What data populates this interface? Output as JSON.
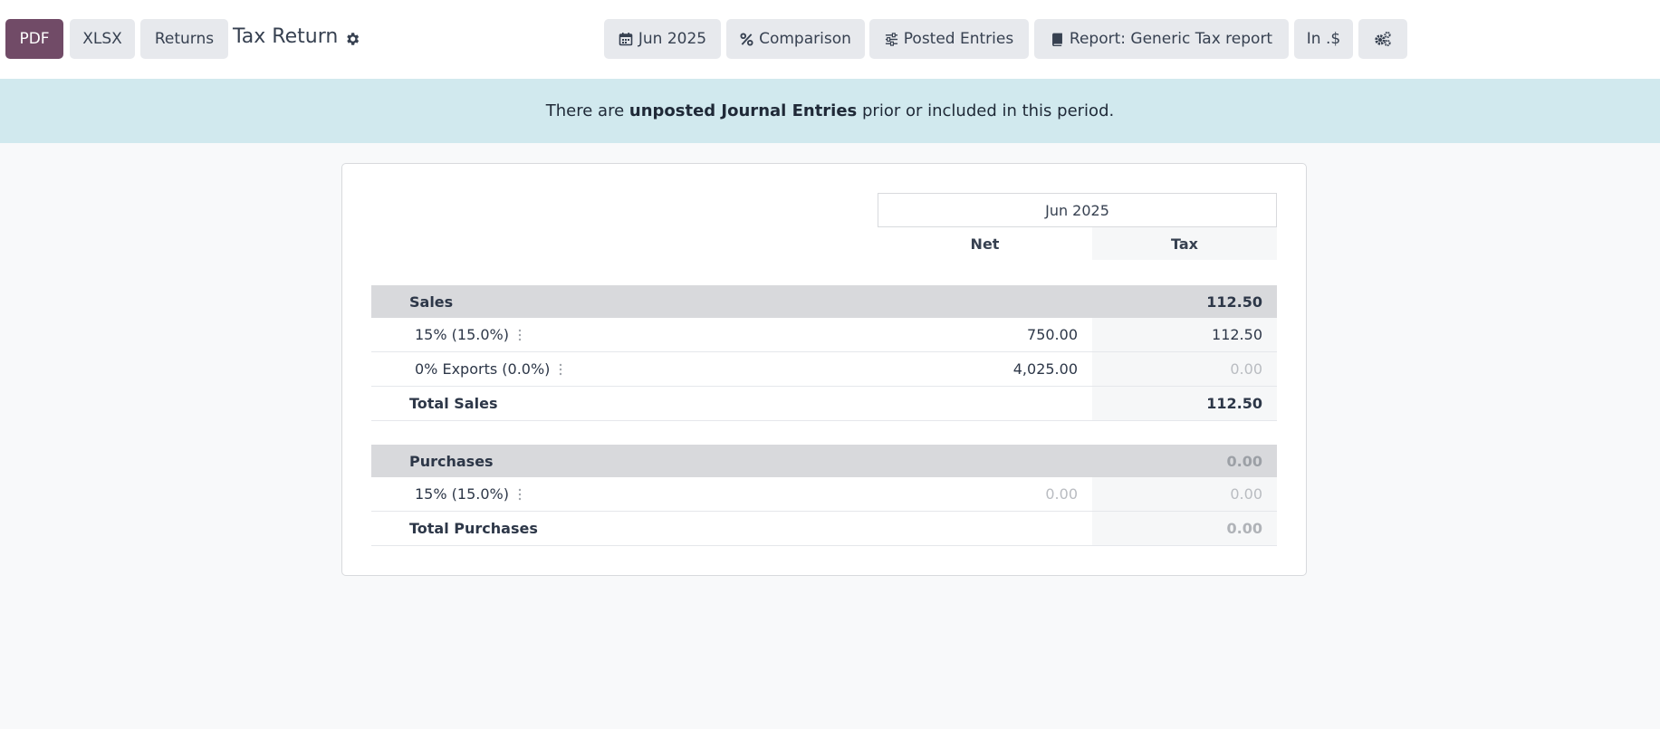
{
  "toolbar": {
    "pdf": "PDF",
    "xlsx": "XLSX",
    "returns": "Returns",
    "title": "Tax Return",
    "period": "Jun 2025",
    "comparison": "Comparison",
    "posted": "Posted Entries",
    "report": "Report: Generic Tax report",
    "currency": "In .$",
    "icons": {
      "settings": "gear-icon",
      "period": "calendar-icon",
      "comparison": "percent-icon",
      "posted": "sliders-icon",
      "report": "book-icon",
      "options": "cogs-icon"
    }
  },
  "alert": {
    "before": "There are ",
    "bold": "unposted Journal Entries",
    "after": " prior or included in this period."
  },
  "table": {
    "period_header": "Jun 2025",
    "columns": [
      "Net",
      "Tax"
    ],
    "sections": [
      {
        "label": "Sales",
        "tax": "112.50",
        "lines": [
          {
            "label": "15% (15.0%)",
            "net": "750.00",
            "tax": "112.50"
          },
          {
            "label": "0% Exports (0.0%)",
            "net": "4,025.00",
            "tax": "0.00"
          }
        ],
        "total_label": "Total Sales",
        "total_tax": "112.50"
      },
      {
        "label": "Purchases",
        "tax": "0.00",
        "lines": [
          {
            "label": "15% (15.0%)",
            "net": "0.00",
            "tax": "0.00"
          }
        ],
        "total_label": "Total Purchases",
        "total_tax": "0.00"
      }
    ]
  },
  "colors": {
    "primary": "#714b67",
    "alert_bg": "#d1e9ee",
    "section_bg": "#d8d9dc"
  }
}
